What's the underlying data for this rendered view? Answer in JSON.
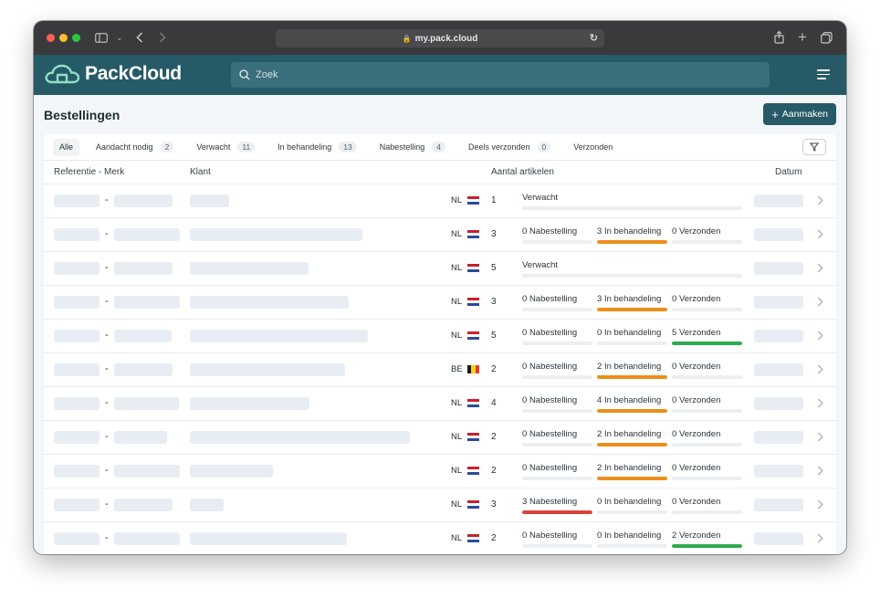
{
  "browser": {
    "url": "my.pack.cloud"
  },
  "app": {
    "name": "PackCloud",
    "search_placeholder": "Zoek"
  },
  "page": {
    "title": "Bestellingen",
    "create_label": "Aanmaken"
  },
  "tabs": [
    {
      "label": "Alle",
      "count": ""
    },
    {
      "label": "Aandacht nodig",
      "count": "2"
    },
    {
      "label": "Verwacht",
      "count": "11"
    },
    {
      "label": "In behandeling",
      "count": "13"
    },
    {
      "label": "Nabestelling",
      "count": "4"
    },
    {
      "label": "Deels verzonden",
      "count": "0"
    },
    {
      "label": "Verzonden",
      "count": ""
    }
  ],
  "columns": {
    "reference": "Referentie - Merk",
    "client": "Klant",
    "articles": "Aantal artikelen",
    "date": "Datum"
  },
  "status_labels": {
    "expected": "Verwacht",
    "backorder": "Nabestelling",
    "processing": "In behandeling",
    "shipped": "Verzonden"
  },
  "colors": {
    "backorder": "#d9443a",
    "processing": "#ec8f1c",
    "shipped": "#2eab4f",
    "brand": "#265a66"
  },
  "orders": [
    {
      "country": "NL",
      "qty": 1,
      "status": "expected"
    },
    {
      "country": "NL",
      "qty": 3,
      "backorder": 0,
      "processing": 3,
      "shipped": 0
    },
    {
      "country": "NL",
      "qty": 5,
      "status": "expected"
    },
    {
      "country": "NL",
      "qty": 3,
      "backorder": 0,
      "processing": 3,
      "shipped": 0
    },
    {
      "country": "NL",
      "qty": 5,
      "backorder": 0,
      "processing": 0,
      "shipped": 5
    },
    {
      "country": "BE",
      "qty": 2,
      "backorder": 0,
      "processing": 2,
      "shipped": 0
    },
    {
      "country": "NL",
      "qty": 4,
      "backorder": 0,
      "processing": 4,
      "shipped": 0
    },
    {
      "country": "NL",
      "qty": 2,
      "backorder": 0,
      "processing": 2,
      "shipped": 0
    },
    {
      "country": "NL",
      "qty": 2,
      "backorder": 0,
      "processing": 2,
      "shipped": 0
    },
    {
      "country": "NL",
      "qty": 3,
      "backorder": 3,
      "processing": 0,
      "shipped": 0
    },
    {
      "country": "NL",
      "qty": 2,
      "backorder": 0,
      "processing": 0,
      "shipped": 2
    }
  ]
}
